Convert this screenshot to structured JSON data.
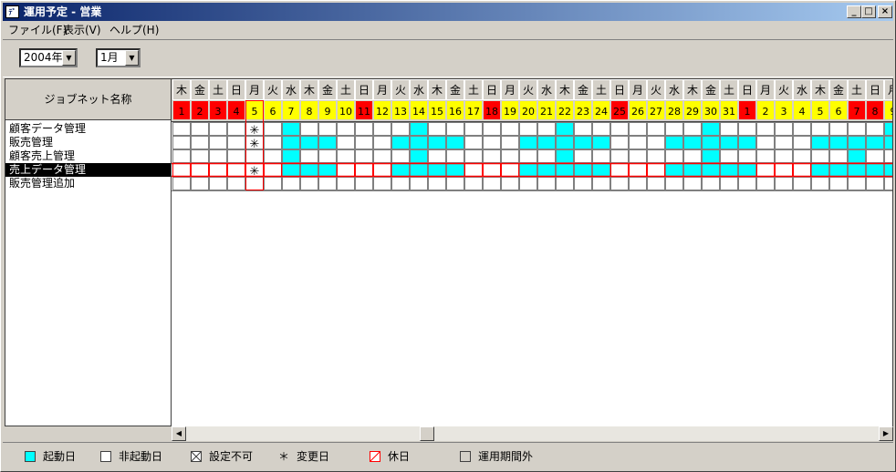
{
  "window": {
    "title": "運用予定 - 営業",
    "icon_text": "ﾃﾞ",
    "minimize": "_",
    "maximize": "□",
    "close": "×"
  },
  "menu": [
    "ファイル(F)",
    "表示(V)",
    "ヘルプ(H)"
  ],
  "toolbar": {
    "year": "2004年",
    "month": "1月",
    "dropdown_arrow": "▼"
  },
  "list_header": "ジョブネット名称",
  "jobs": [
    "顧客データ管理",
    "販売管理",
    "顧客売上管理",
    "売上データ管理",
    "販売管理追加"
  ],
  "selected_job": 3,
  "calendar": {
    "weekdays": [
      "木",
      "金",
      "土",
      "日",
      "月",
      "火",
      "水",
      "木",
      "金",
      "土",
      "日",
      "月",
      "火",
      "水",
      "木",
      "金",
      "土",
      "日",
      "月",
      "火",
      "水",
      "木",
      "金",
      "土",
      "日",
      "月",
      "火",
      "水",
      "木",
      "金",
      "土",
      "日",
      "月",
      "火",
      "水",
      "木",
      "金",
      "土",
      "日",
      "月"
    ],
    "days": [
      "1",
      "2",
      "3",
      "4",
      "5",
      "6",
      "7",
      "8",
      "9",
      "10",
      "11",
      "12",
      "13",
      "14",
      "15",
      "16",
      "17",
      "18",
      "19",
      "20",
      "21",
      "22",
      "23",
      "24",
      "25",
      "26",
      "27",
      "28",
      "29",
      "30",
      "31",
      "1",
      "2",
      "3",
      "4",
      "5",
      "6",
      "7",
      "8",
      "9"
    ],
    "day_types": [
      "R",
      "R",
      "R",
      "R",
      "Y",
      "Y",
      "Y",
      "Y",
      "Y",
      "Y",
      "R",
      "Y",
      "Y",
      "Y",
      "Y",
      "Y",
      "Y",
      "R",
      "Y",
      "Y",
      "Y",
      "Y",
      "Y",
      "Y",
      "R",
      "Y",
      "Y",
      "Y",
      "Y",
      "Y",
      "Y",
      "R",
      "Y",
      "Y",
      "Y",
      "Y",
      "Y",
      "R",
      "R",
      "Y"
    ],
    "rows": [
      "....X.C......C.......C.......C.........C",
      "....X.CCC...CCCC...CCCCC...CCCCC...CCCCC",
      "......C......C.......C.......C.......C..",
      "HHHHXHCCCHHHCCCCHHHCCCCCHHHCCCCCHHHCCCCC",
      "........................................"
    ],
    "change_mark": "✳",
    "colors": {
      "holiday": "#ff0000",
      "workday": "#ffff00",
      "startup": "#00ffff",
      "holiday_line": "#ff0000",
      "gridline": "#808080"
    }
  },
  "scrollbar": {
    "left_arrow": "◀",
    "right_arrow": "▶"
  },
  "legend": {
    "startup": "起動日",
    "non_startup": "非起動日",
    "unsettable": "設定不可",
    "changed_symbol": "＊",
    "changed": "変更日",
    "holiday": "休日",
    "out_of_period": "運用期間外"
  }
}
